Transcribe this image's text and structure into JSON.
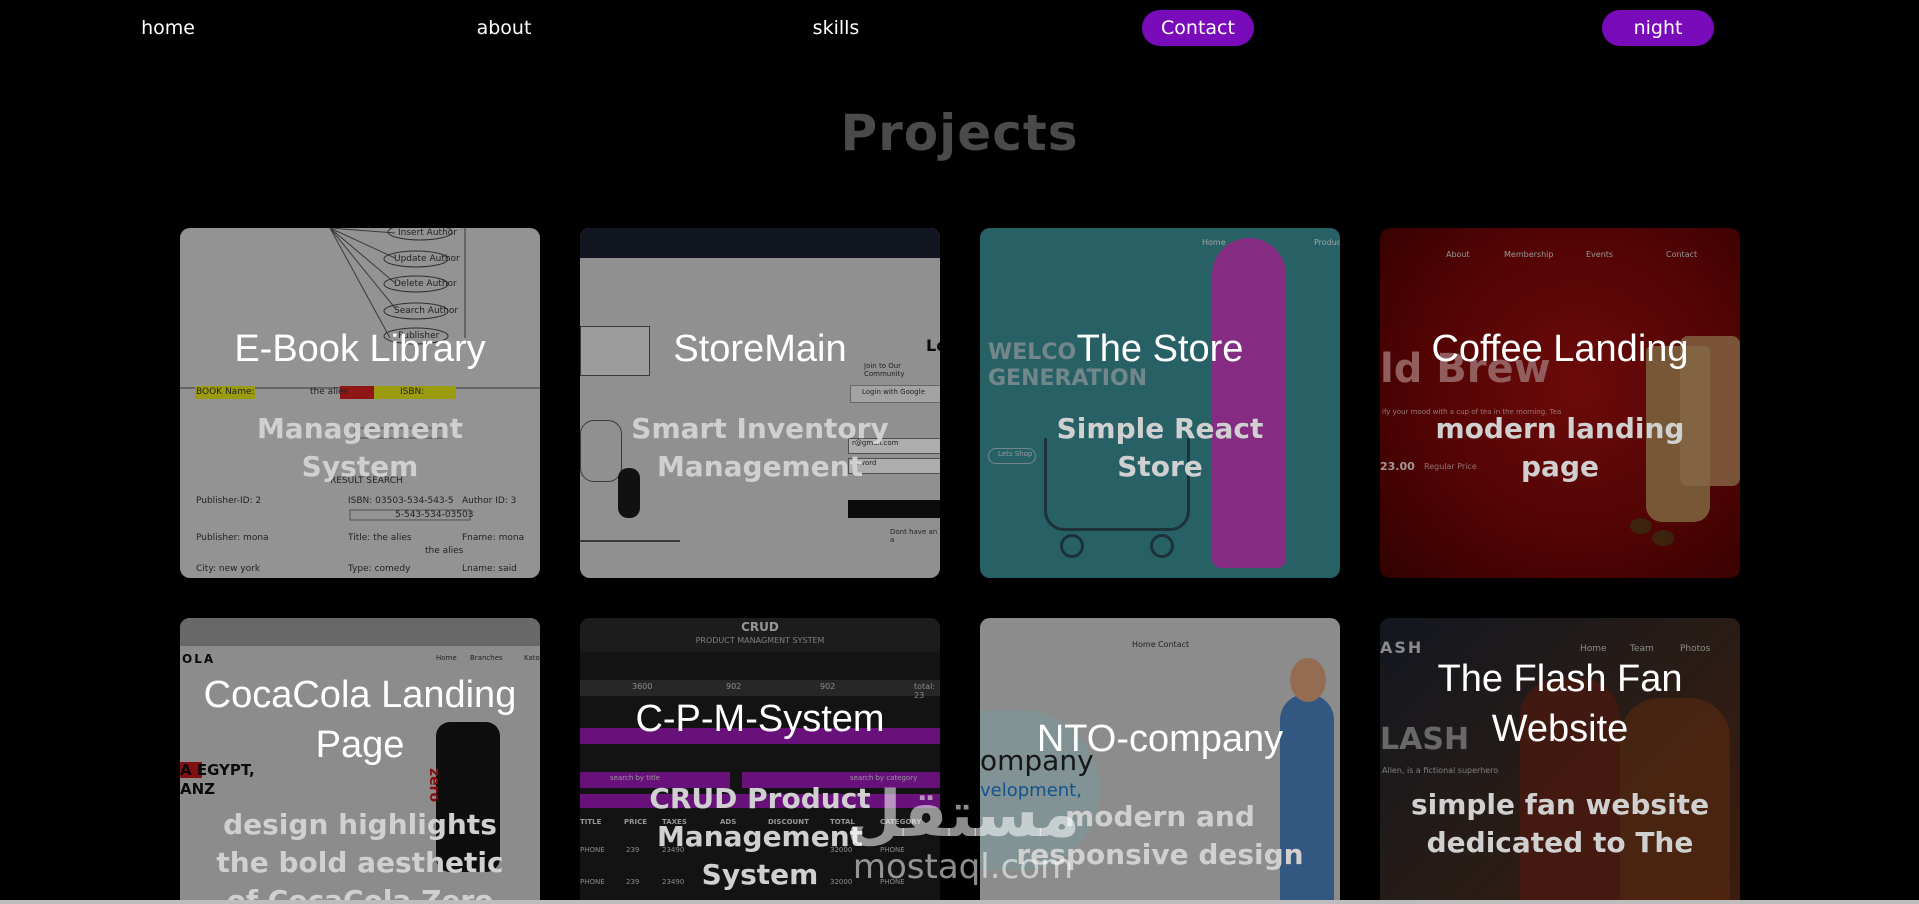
{
  "nav": {
    "home": "home",
    "about": "about",
    "skills": "skills",
    "contact": "Contact",
    "night": "night"
  },
  "colors": {
    "accent": "#7a0bbb",
    "background": "#000000",
    "title": "#4a4a4a"
  },
  "section": {
    "title": "Projects"
  },
  "projects": [
    {
      "title": "E-Book Library",
      "desc": "Management System"
    },
    {
      "title": "StoreMain",
      "desc": "Smart Inventory Management"
    },
    {
      "title": "The Store",
      "desc": "Simple React Store"
    },
    {
      "title": "Coffee Landing",
      "desc": "modern landing page"
    },
    {
      "title": "CocaCola Landing Page",
      "desc": "design highlights the bold aesthetic of CocaCola Zero"
    },
    {
      "title": "C-P-M-System",
      "desc": "CRUD Product Management System"
    },
    {
      "title": "NTO-company",
      "desc": "modern and responsive design"
    },
    {
      "title": "The Flash Fan Website",
      "desc": "simple fan website dedicated to The"
    }
  ],
  "screenshots": {
    "ebook": {
      "ovals": [
        "Insert Author",
        "Update Author",
        "Delete Author",
        "Search Author",
        "Publisher"
      ],
      "book_name_label": "BOOK Name:",
      "book_name_value": "the alies",
      "isbn_label": "ISBN:",
      "result_search": "RESULT SEARCH",
      "publisher_id": "Publisher-ID: 2",
      "isbn_value": "ISBN: 03503-534-543-5",
      "author_id": "Author ID: 3",
      "isbn_short": "5-543-534-03503",
      "publisher": "Publisher: mona",
      "title": "Title: the alies",
      "fname": "Fname: mona",
      "title_value": "the alies",
      "city": "City: new york",
      "type": "Type: comedy",
      "lname": "Lname: said"
    },
    "storemain": {
      "login_heading": "Lo",
      "join_text": "Join to Our Community",
      "google_button": "Login with Google",
      "email_value": "r@gmail.com",
      "password_value": "ssword",
      "no_account": "Dont have an a"
    },
    "thestore": {
      "nav_home": "Home",
      "nav_products": "Product",
      "hero_line1": "WELCO",
      "hero_line2": "GENERATION",
      "hero_button": "Lets Shop"
    },
    "coffee": {
      "nav": [
        "About",
        "Membership",
        "Events",
        "Contact"
      ],
      "hero": "ld Brew",
      "tagline": "ify your mood with a cup of tea in the morning. Tea",
      "price": "23.00",
      "regular_price": "Regular Price"
    },
    "coca": {
      "brand": "OLA",
      "nav_home": "Home",
      "nav_branches": "Branches",
      "nav_extra": "Kato",
      "egypt": "A EGYPT,",
      "anz": "ANZ",
      "can": "zero"
    },
    "cpm": {
      "heading": "CRUD",
      "subheading": "PRODUCT MANAGMENT SYSTEM",
      "inputs": [
        "3600",
        "902",
        "902"
      ],
      "total": "total: 23",
      "search_title": "search by title",
      "search_category": "search by category",
      "headers": [
        "TITLE",
        "PRICE",
        "TAXES",
        "ADS",
        "DISCOUNT",
        "TOTAL",
        "CATEGORY"
      ],
      "rows": [
        [
          "PHONE",
          "239",
          "23490",
          "",
          "",
          "32000",
          "PHONE"
        ],
        [
          "PHONE",
          "239",
          "23490",
          "",
          "",
          "32000",
          "PHONE"
        ]
      ]
    },
    "nto": {
      "nav_home": "Home",
      "nav_contact": "Contact",
      "word_company": "ompany",
      "word_development": "velopment,"
    },
    "flash": {
      "brand": "ASH",
      "nav": [
        "Home",
        "Team",
        "Photos"
      ],
      "logo": "LASH",
      "text": "Allen, is a fictional superhero"
    }
  },
  "watermark": {
    "arabic": "مستقل",
    "latin": "mostaql.com"
  }
}
